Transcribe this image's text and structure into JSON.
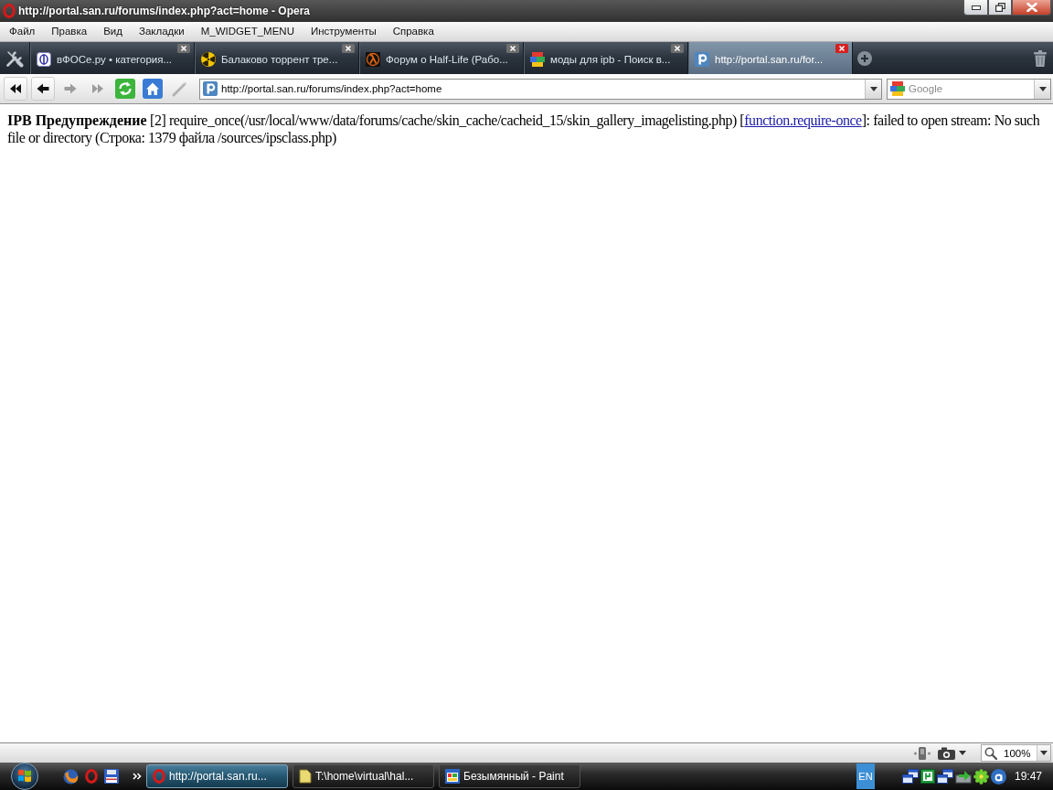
{
  "window": {
    "title": "http://portal.san.ru/forums/index.php?act=home - Opera"
  },
  "menu": [
    "Файл",
    "Правка",
    "Вид",
    "Закладки",
    "M_WIDGET_MENU",
    "Инструменты",
    "Справка"
  ],
  "tabs": [
    {
      "label": "вФОСе.ру • категория...",
      "selected": false
    },
    {
      "label": "Балаково торрент тре...",
      "selected": false
    },
    {
      "label": "Форум о Half-Life (Рабо...",
      "selected": false
    },
    {
      "label": "моды для ipb - Поиск в...",
      "selected": false
    },
    {
      "label": "http://portal.san.ru/for...",
      "selected": true
    }
  ],
  "nav_buttons": [
    {
      "kind": "rewind",
      "disabled": false
    },
    {
      "kind": "back",
      "disabled": false
    },
    {
      "kind": "forward",
      "disabled": true
    },
    {
      "kind": "fast_forward",
      "disabled": true
    },
    {
      "kind": "reload",
      "disabled": false
    },
    {
      "kind": "home",
      "disabled": false
    },
    {
      "kind": "wand",
      "disabled": true
    }
  ],
  "address_bar": {
    "value": "http://portal.san.ru/forums/index.php?act=home"
  },
  "search": {
    "placeholder": "Google"
  },
  "page": {
    "message": {
      "text_before": "**IPB Предупреждение** [2] require_once(/usr/local/www/data/forums/cache/skin_cache/cacheid_15/skin_gallery_imagelisting.php) [",
      "link": "function.require-once",
      "text_after": "]: failed to open stream: No such file or directory (Строка: 1379 файла /sources/ipsclass.php)"
    }
  },
  "status_bar": {
    "zoom": "100%"
  },
  "taskbar": {
    "tasks": [
      {
        "label": "http://portal.san.ru...",
        "selected": true
      },
      {
        "label": "T:\\home\\virtual\\hal...",
        "selected": false
      },
      {
        "label": "Безымянный - Paint",
        "selected": false
      }
    ],
    "language": "EN",
    "clock": "19:47"
  }
}
